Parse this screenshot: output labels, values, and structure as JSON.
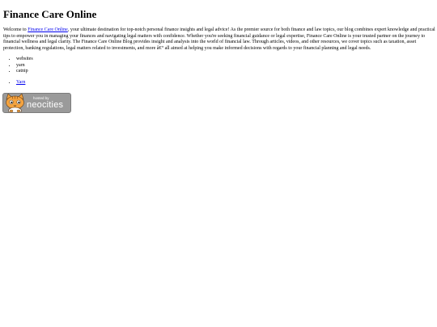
{
  "page": {
    "title": "Finance Care Online",
    "intro_lead": "Welcome to ",
    "intro_link": "Finance Care Online",
    "intro_rest": ", your ultimate destination for top-notch personal finance insights and legal advice! As the premier source for both finance and law topics, our blog combines expert knowledge and practical tips to empower you in managing your finances and navigating legal matters with confidence. Whether you're seeking financial guidance or legal expertise, Finance Care Online is your trusted partner on the journey to financial wellness and legal clarity. The Finance Care Online Blog provides insight and analysis into the world of financial law. Through articles, videos, and other resources, we cover topics such as taxation, asset protection, banking regulations, legal matters related to investments, and more â€“ all aimed at helping you make informed decisions with regards to your financial planning and legal needs.",
    "tags": [
      "websites",
      "yarn",
      "catnip"
    ],
    "links": [
      "Yarn"
    ]
  },
  "badge": {
    "small_text": "hosted by",
    "big_text": "neocities",
    "colors": {
      "background": "#9a9a9a",
      "cat_fur": "#f4a340",
      "text": "#ffffff"
    }
  }
}
